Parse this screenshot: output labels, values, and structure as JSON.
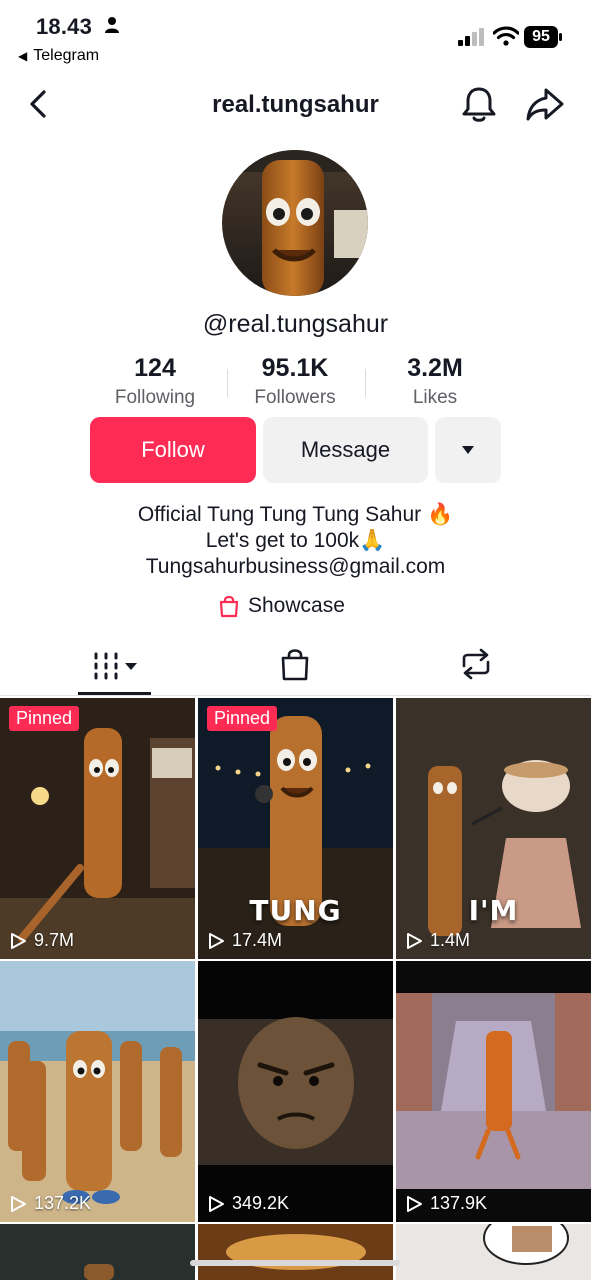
{
  "status_bar": {
    "time": "18.43",
    "back_app": "Telegram",
    "battery": "95"
  },
  "header": {
    "title": "real.tungsahur",
    "icons": [
      "back-icon",
      "bell-icon",
      "share-icon"
    ]
  },
  "profile": {
    "handle": "@real.tungsahur",
    "stats": [
      {
        "value": "124",
        "label": "Following"
      },
      {
        "value": "95.1K",
        "label": "Followers"
      },
      {
        "value": "3.2M",
        "label": "Likes"
      }
    ],
    "buttons": {
      "follow": "Follow",
      "message": "Message"
    },
    "bio": [
      "Official Tung Tung Tung Sahur 🔥",
      "Let's get to 100k🙏",
      "Tungsahurbusiness@gmail.com"
    ],
    "showcase": "Showcase"
  },
  "tabs": [
    "videos-grid-icon",
    "shop-bag-icon",
    "repost-icon"
  ],
  "videos": [
    {
      "views": "9.7M",
      "pinned": "Pinned",
      "caption": ""
    },
    {
      "views": "17.4M",
      "pinned": "Pinned",
      "caption": "TUNG"
    },
    {
      "views": "1.4M",
      "pinned": "",
      "caption": "I'M"
    },
    {
      "views": "137.2K",
      "pinned": "",
      "caption": ""
    },
    {
      "views": "349.2K",
      "pinned": "",
      "caption": ""
    },
    {
      "views": "137.9K",
      "pinned": "",
      "caption": ""
    }
  ],
  "colors": {
    "accent": "#fe2c55",
    "secondary_button": "#f1f1f2",
    "text": "#161823",
    "muted": "#5f6166"
  }
}
